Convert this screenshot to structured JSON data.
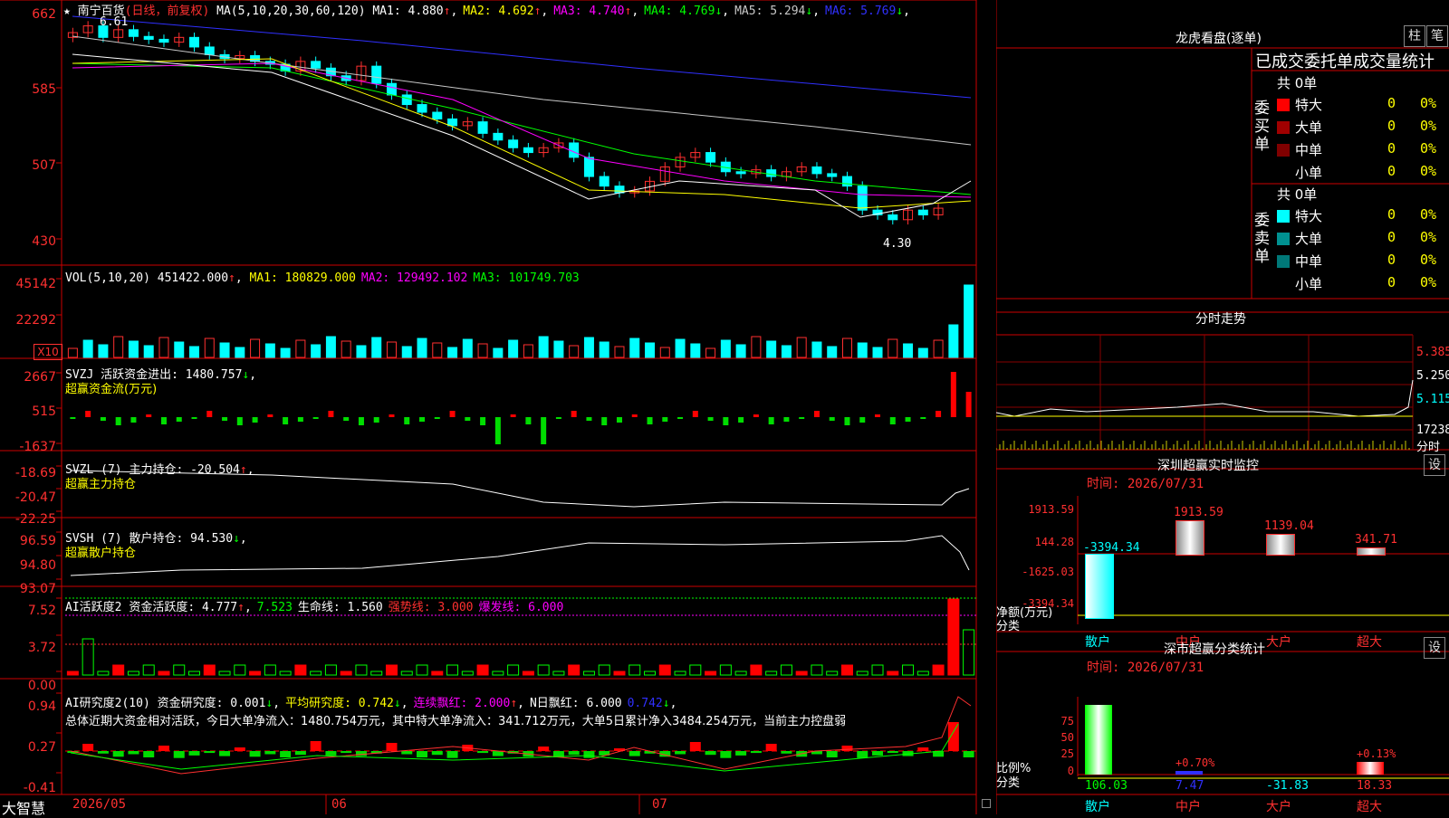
{
  "stock": {
    "name": "南宁百货",
    "period": "(日线，前复权)",
    "star": "★"
  },
  "main_panel": {
    "ma_prefix": "MA(5,10,20,30,60,120)",
    "ma": [
      {
        "label": "MA1:",
        "value": "4.880",
        "arrow": "↑",
        "color": "#ffffff"
      },
      {
        "label": "MA2:",
        "value": "4.692",
        "arrow": "↑",
        "color": "#ffff00"
      },
      {
        "label": "MA3:",
        "value": "4.740",
        "arrow": "↑",
        "color": "#ff00ff"
      },
      {
        "label": "MA4:",
        "value": "4.769",
        "arrow": "↓",
        "color": "#00ff00"
      },
      {
        "label": "MA5:",
        "value": "5.294",
        "arrow": "↓",
        "color": "#c8c8c8"
      },
      {
        "label": "MA6:",
        "value": "5.769",
        "arrow": "↓",
        "color": "#3030ff"
      }
    ],
    "y_ticks": [
      "662",
      "585",
      "507",
      "430"
    ],
    "high_mark": "6.61",
    "low_mark": "4.30"
  },
  "vol_panel": {
    "prefix": "VOL(5,10,20)",
    "value": "451422.000",
    "ma": [
      {
        "label": "MA1:",
        "value": "180829.000",
        "color": "#ffff00"
      },
      {
        "label": "MA2:",
        "value": "129492.102",
        "color": "#ff00ff"
      },
      {
        "label": "MA3:",
        "value": "101749.703",
        "color": "#00ff00"
      }
    ],
    "y_ticks": [
      "45142",
      "22292"
    ],
    "unit": "X10"
  },
  "svzj_panel": {
    "line1": "SVZJ  活跃资金进出: 1480.757",
    "arrow": "↓",
    "line2": "超赢资金流(万元)",
    "y_ticks": [
      "2667",
      "515",
      "-1637"
    ]
  },
  "svzl_panel": {
    "line1": "SVZL (7) 主力持仓: -20.504",
    "arrow": "↑",
    "line2": "超赢主力持仓",
    "y_ticks": [
      "-18.69",
      "-20.47",
      "-22.25"
    ]
  },
  "svsh_panel": {
    "line1": "SVSH (7) 散户持仓: 94.530",
    "arrow": "↓",
    "line2": "超赢散户持仓",
    "y_ticks": [
      "96.59",
      "94.80",
      "93.07"
    ]
  },
  "ai1_panel": {
    "title": "AI活跃度2",
    "items": [
      {
        "text": "资金活跃度: 4.777",
        "arrow": "↑",
        "color": "#ffffff"
      },
      {
        "text": "7.523",
        "arrow": "",
        "color": "#00ff00"
      },
      {
        "text": "生命线: 1.560",
        "arrow": "",
        "color": "#ffffff"
      },
      {
        "text": "强势线: 3.000",
        "arrow": "",
        "color": "#ff3030"
      },
      {
        "text": "爆发线: 6.000",
        "arrow": "",
        "color": "#ff00ff"
      }
    ],
    "y_ticks": [
      "7.52",
      "3.72",
      "0.00"
    ]
  },
  "ai2_panel": {
    "title": "AI研究度2(10)",
    "items": [
      {
        "text": "资金研究度: 0.001",
        "arrow": "↓",
        "color": "#ffffff"
      },
      {
        "text": "平均研究度: 0.742",
        "arrow": "↓",
        "color": "#ffff00"
      },
      {
        "text": "连续飘红: 2.000",
        "arrow": "↑",
        "color": "#ff00ff"
      },
      {
        "text": "N日飘红: 6.000",
        "arrow": "",
        "color": "#ffffff"
      },
      {
        "text": "0.742",
        "arrow": "↓",
        "color": "#3030ff"
      }
    ],
    "summary": "总体近期大资金相对活跃，今日大单净流入：1480.754万元，其中特大单净流入：341.712万元，大单5日累计净入3484.254万元，当前主力控盘弱",
    "y_ticks": [
      "0.94",
      "0.27",
      "-0.41"
    ]
  },
  "bottom": {
    "brand": "大智慧",
    "dates": [
      "2026/05",
      "06",
      "07"
    ]
  },
  "dragon": {
    "title": "龙虎看盘(逐单)",
    "btn1": "柱",
    "btn2": "笔",
    "header": "已成交委托单成交量统计",
    "buy": {
      "label": "委买单",
      "total": "共 0单",
      "rows": [
        {
          "name": "特大",
          "count": "0",
          "pct": "0%",
          "color": "#ff0000"
        },
        {
          "name": "大单",
          "count": "0",
          "pct": "0%",
          "color": "#a00000"
        },
        {
          "name": "中单",
          "count": "0",
          "pct": "0%",
          "color": "#800000"
        },
        {
          "name": "小单",
          "count": "0",
          "pct": "0%",
          "color": ""
        }
      ]
    },
    "sell": {
      "label": "委卖单",
      "total": "共 0单",
      "rows": [
        {
          "name": "特大",
          "count": "0",
          "pct": "0%",
          "color": "#00ffff"
        },
        {
          "name": "大单",
          "count": "0",
          "pct": "0%",
          "color": "#009090"
        },
        {
          "name": "中单",
          "count": "0",
          "pct": "0%",
          "color": "#007878"
        },
        {
          "name": "小单",
          "count": "0",
          "pct": "0%",
          "color": ""
        }
      ]
    }
  },
  "intraday": {
    "title": "分时走势",
    "prices": [
      "5.385",
      "5.250",
      "5.115"
    ],
    "vol": "17238",
    "vol_label": "分时"
  },
  "monitor": {
    "title": "深圳超赢实时监控",
    "btn": "设",
    "time": "时间: 2026/07/31",
    "y_ticks": [
      "1913.59",
      "144.28",
      "-1625.03",
      "-3394.34"
    ],
    "bars": [
      {
        "name": "散户",
        "value": "-3394.34"
      },
      {
        "name": "中户",
        "value": "1913.59"
      },
      {
        "name": "大户",
        "value": "1139.04"
      },
      {
        "name": "超大",
        "value": "341.71"
      }
    ],
    "label1": "净额(万元)",
    "label2": "分类"
  },
  "stats": {
    "title": "深市超赢分类统计",
    "btn": "设",
    "time": "时间: 2026/07/31",
    "y_ticks": [
      "75",
      "50",
      "25",
      "0"
    ],
    "bars": [
      {
        "name": "散户",
        "value": "106.03"
      },
      {
        "name": "中户",
        "value": "7.47",
        "note": "+0.70%"
      },
      {
        "name": "大户",
        "value": "-31.83"
      },
      {
        "name": "超大",
        "value": "18.33",
        "note": "+0.13%"
      }
    ],
    "label1": "比例%",
    "label2": "分类"
  }
}
